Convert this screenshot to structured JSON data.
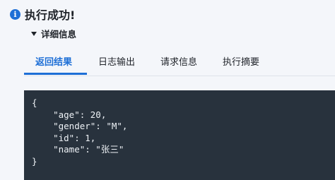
{
  "status": {
    "icon": "info-icon",
    "icon_glyph": "i",
    "text": "执行成功!"
  },
  "details": {
    "label": "详细信息"
  },
  "tabs": [
    {
      "label": "返回结果",
      "active": true
    },
    {
      "label": "日志输出",
      "active": false
    },
    {
      "label": "请求信息",
      "active": false
    },
    {
      "label": "执行摘要",
      "active": false
    }
  ],
  "result": {
    "json_text": "{\n    \"age\": 20,\n    \"gender\": \"M\",\n    \"id\": 1,\n    \"name\": \"张三\"\n}"
  },
  "colors": {
    "accent": "#1e6fd6",
    "code_background": "#28323d",
    "page_background": "#f4f6fa"
  }
}
